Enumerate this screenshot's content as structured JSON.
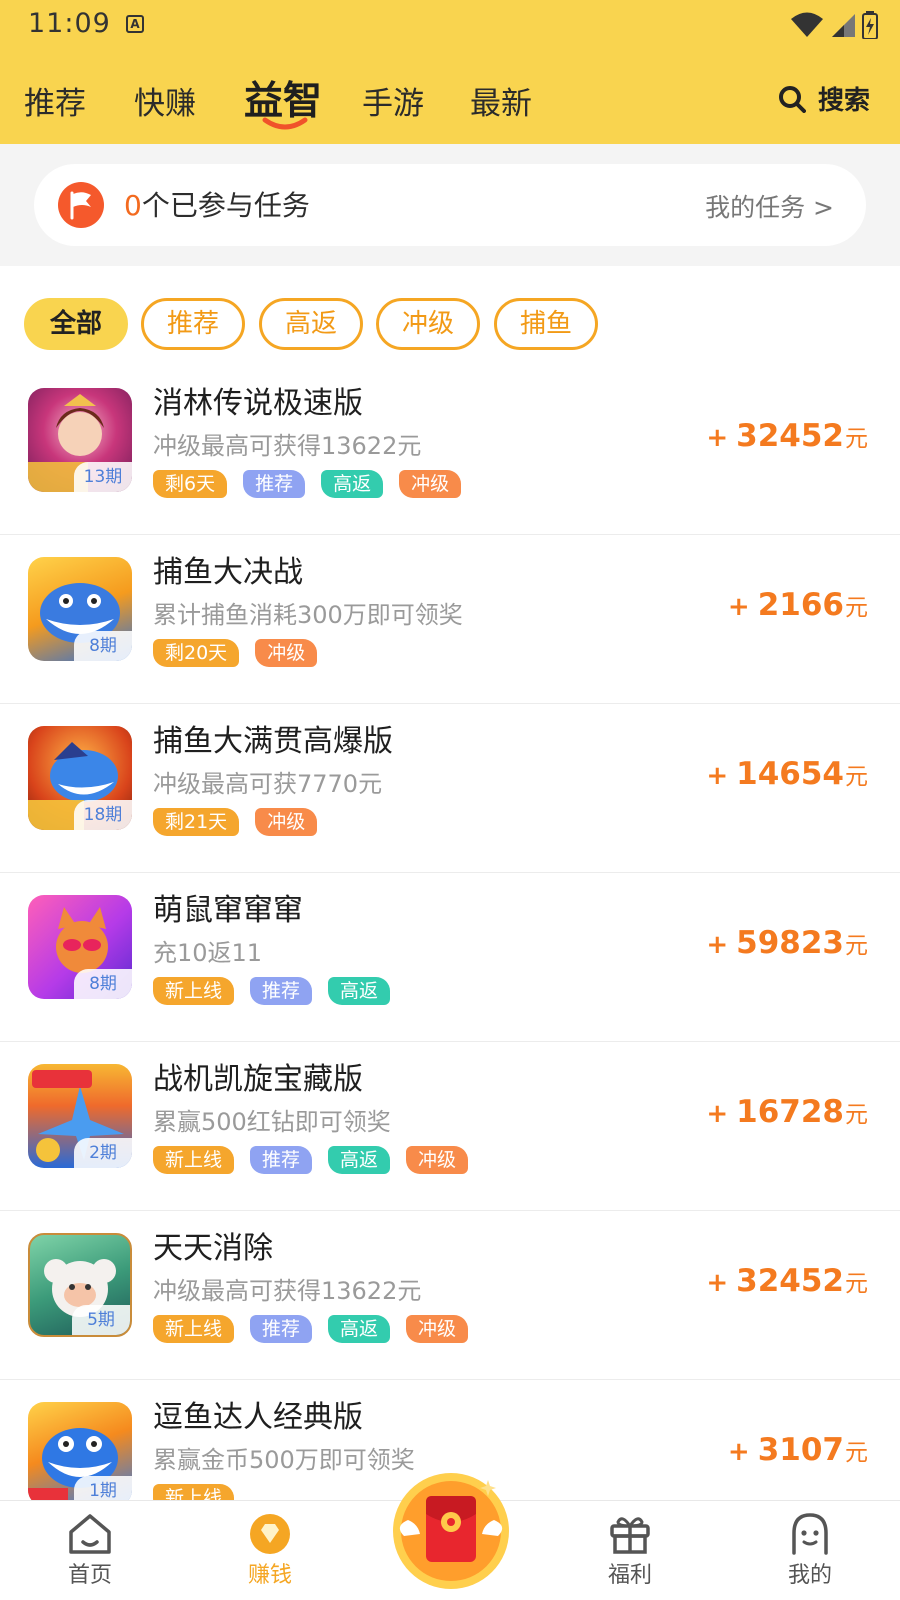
{
  "status_bar": {
    "time": "11:09",
    "notif_icon": "A"
  },
  "tabs": [
    "推荐",
    "快赚",
    "益智",
    "手游",
    "最新"
  ],
  "active_tab": "益智",
  "search_label": "搜索",
  "task": {
    "count": "0",
    "text": "个已参与任务",
    "link": "我的任务 >"
  },
  "filters": [
    "全部",
    "推荐",
    "高返",
    "冲级",
    "捕鱼"
  ],
  "active_filter": "全部",
  "tag_colors": {
    "remaining": "#f5a62d",
    "new": "#f5a62d",
    "推荐": "#8fa3f2",
    "高返": "#33ccae",
    "冲级": "#f88b4a"
  },
  "items": [
    {
      "title": "消林传说极速版",
      "desc": "冲级最高可获得13622元",
      "period": "13期",
      "plus": "+",
      "amount": "32452",
      "unit": "元",
      "tags": [
        "剩6天",
        "推荐",
        "高返",
        "冲级"
      ],
      "tag_types": [
        "remaining",
        "推荐",
        "高返",
        "冲级"
      ]
    },
    {
      "title": "捕鱼大决战",
      "desc": "累计捕鱼消耗300万即可领奖",
      "period": "8期",
      "plus": "+",
      "amount": "2166",
      "unit": "元",
      "tags": [
        "剩20天",
        "冲级"
      ],
      "tag_types": [
        "remaining",
        "冲级"
      ]
    },
    {
      "title": "捕鱼大满贯高爆版",
      "desc": "冲级最高可获7770元",
      "period": "18期",
      "plus": "+",
      "amount": "14654",
      "unit": "元",
      "tags": [
        "剩21天",
        "冲级"
      ],
      "tag_types": [
        "remaining",
        "冲级"
      ]
    },
    {
      "title": "萌鼠窜窜窜",
      "desc": "充10返11",
      "period": "8期",
      "plus": "+",
      "amount": "59823",
      "unit": "元",
      "tags": [
        "新上线",
        "推荐",
        "高返"
      ],
      "tag_types": [
        "new",
        "推荐",
        "高返"
      ]
    },
    {
      "title": "战机凯旋宝藏版",
      "desc": "累赢500红钻即可领奖",
      "period": "2期",
      "plus": "+",
      "amount": "16728",
      "unit": "元",
      "tags": [
        "新上线",
        "推荐",
        "高返",
        "冲级"
      ],
      "tag_types": [
        "new",
        "推荐",
        "高返",
        "冲级"
      ]
    },
    {
      "title": "天天消除",
      "desc": "冲级最高可获得13622元",
      "period": "5期",
      "plus": "+",
      "amount": "32452",
      "unit": "元",
      "tags": [
        "新上线",
        "推荐",
        "高返",
        "冲级"
      ],
      "tag_types": [
        "new",
        "推荐",
        "高返",
        "冲级"
      ]
    },
    {
      "title": "逗鱼达人经典版",
      "desc": "累赢金币500万即可领奖",
      "period": "1期",
      "plus": "+",
      "amount": "3107",
      "unit": "元",
      "tags": [
        "新上线"
      ],
      "tag_types": [
        "new"
      ]
    }
  ],
  "bottom_nav": [
    {
      "label": "首页",
      "icon": "home-icon"
    },
    {
      "label": "赚钱",
      "icon": "earn-icon"
    },
    {
      "label": "",
      "icon": "red-envelope-icon"
    },
    {
      "label": "福利",
      "icon": "gift-icon"
    },
    {
      "label": "我的",
      "icon": "profile-icon"
    }
  ],
  "colors": {
    "header": "#f9d44f",
    "accent": "#f47a1f",
    "chip_border": "#f5a623"
  }
}
